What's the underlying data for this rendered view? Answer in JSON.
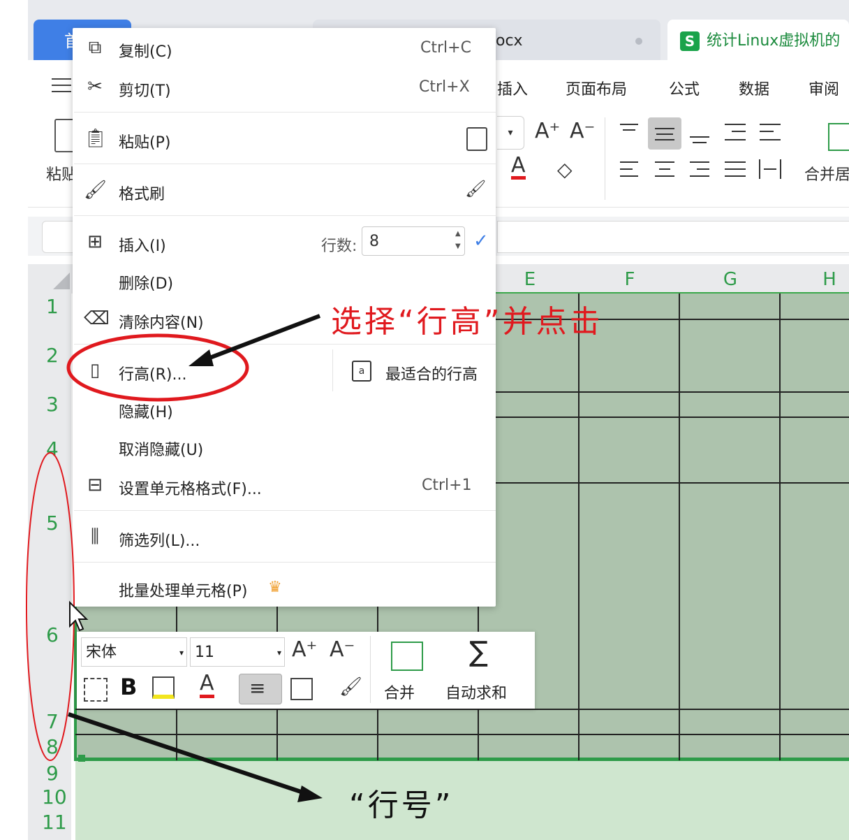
{
  "tabs": {
    "home_label": "首",
    "doc_label": "ocx",
    "active_label": "统计Linux虚拟机的"
  },
  "ribbon": {
    "menu_tabs": [
      "插入",
      "页面布局",
      "公式",
      "数据",
      "审阅"
    ],
    "paste_label": "粘贴",
    "merge_label": "合并居",
    "font_grow": "A⁺",
    "font_shrink": "A⁻"
  },
  "columns": [
    "E",
    "F",
    "G",
    "H"
  ],
  "rows": [
    "1",
    "2",
    "3",
    "4",
    "5",
    "6",
    "7",
    "8",
    "9",
    "10",
    "11"
  ],
  "context_menu": {
    "copy": {
      "label": "复制(C)",
      "shortcut": "Ctrl+C"
    },
    "cut": {
      "label": "剪切(T)",
      "shortcut": "Ctrl+X"
    },
    "paste": {
      "label": "粘贴(P)"
    },
    "format_painter": {
      "label": "格式刷"
    },
    "insert": {
      "label": "插入(I)",
      "rows_label": "行数:",
      "rows_value": "8"
    },
    "delete": {
      "label": "删除(D)"
    },
    "clear": {
      "label": "清除内容(N)"
    },
    "row_height": {
      "label": "行高(R)...",
      "best_fit": "最适合的行高"
    },
    "hide": {
      "label": "隐藏(H)"
    },
    "unhide": {
      "label": "取消隐藏(U)"
    },
    "format_cells": {
      "label": "设置单元格格式(F)...",
      "shortcut": "Ctrl+1"
    },
    "filter": {
      "label": "筛选列(L)..."
    },
    "batch": {
      "label": "批量处理单元格(P)"
    }
  },
  "mini_toolbar": {
    "font_name": "宋体",
    "font_size": "11",
    "merge_label": "合并",
    "autosum_label": "自动求和",
    "bold": "B"
  },
  "annotations": {
    "select_row_height": "选择“行高”并点击",
    "row_number": "“行号”"
  },
  "colors": {
    "accent_blue": "#3f7fe6",
    "green_header": "#2e9b49",
    "selection_fill": "#adc3ad",
    "annotation_red": "#e0191e"
  }
}
